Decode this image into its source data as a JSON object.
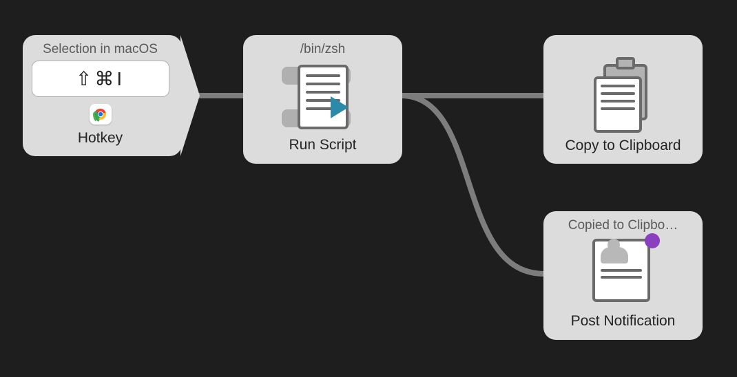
{
  "nodes": {
    "hotkey": {
      "header": "Selection in macOS",
      "keys": "⇧⌘I",
      "footer": "Hotkey",
      "app_icon": "chrome"
    },
    "script": {
      "header": "/bin/zsh",
      "footer": "Run Script"
    },
    "clipboard": {
      "header": "",
      "footer": "Copy to Clipboard"
    },
    "notify": {
      "header": "Copied to Clipbo…",
      "footer": "Post Notification"
    }
  },
  "connections": [
    {
      "from": "hotkey",
      "to": "script"
    },
    {
      "from": "script",
      "to": "clipboard"
    },
    {
      "from": "script",
      "to": "notify"
    }
  ],
  "colors": {
    "bg": "#1e1e1e",
    "node": "#dcdcdc",
    "line": "#7d7d7d",
    "badge": "#8a3fbf",
    "play": "#2a8aa8"
  }
}
